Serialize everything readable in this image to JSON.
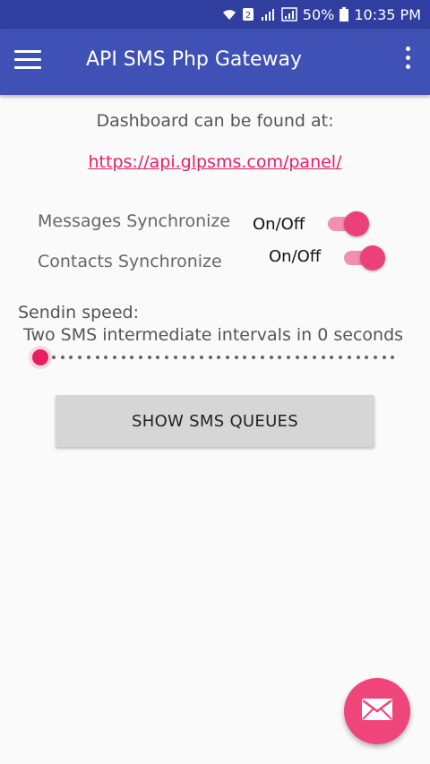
{
  "status_bar": {
    "battery": "50%",
    "time": "10:35 PM",
    "sim_label": "2",
    "icons": [
      "wifi-icon",
      "sim-icon",
      "signal-icon",
      "signal-icon",
      "battery-icon"
    ]
  },
  "app_bar": {
    "title": "API SMS Php Gateway",
    "menu_icon": "hamburger-menu-icon",
    "overflow_icon": "more-vert-icon",
    "color": "#3f51b5"
  },
  "dashboard": {
    "label": "Dashboard can be found at:",
    "link": "https://api.glpsms.com/panel/"
  },
  "sync": {
    "messages": {
      "label": "Messages Synchronize",
      "switch_label": "On/Off",
      "on": true
    },
    "contacts": {
      "label": "Contacts Synchronize",
      "switch_label": "On/Off",
      "on": true
    }
  },
  "speed": {
    "label": "Sendin speed:",
    "interval_text": "Two SMS intermediate intervals in 0 seconds",
    "value": 0
  },
  "queue_button": {
    "label": "SHOW SMS QUEUES"
  },
  "fab": {
    "icon": "mail-icon",
    "color": "#f0457b"
  },
  "accent": "#e91e63"
}
